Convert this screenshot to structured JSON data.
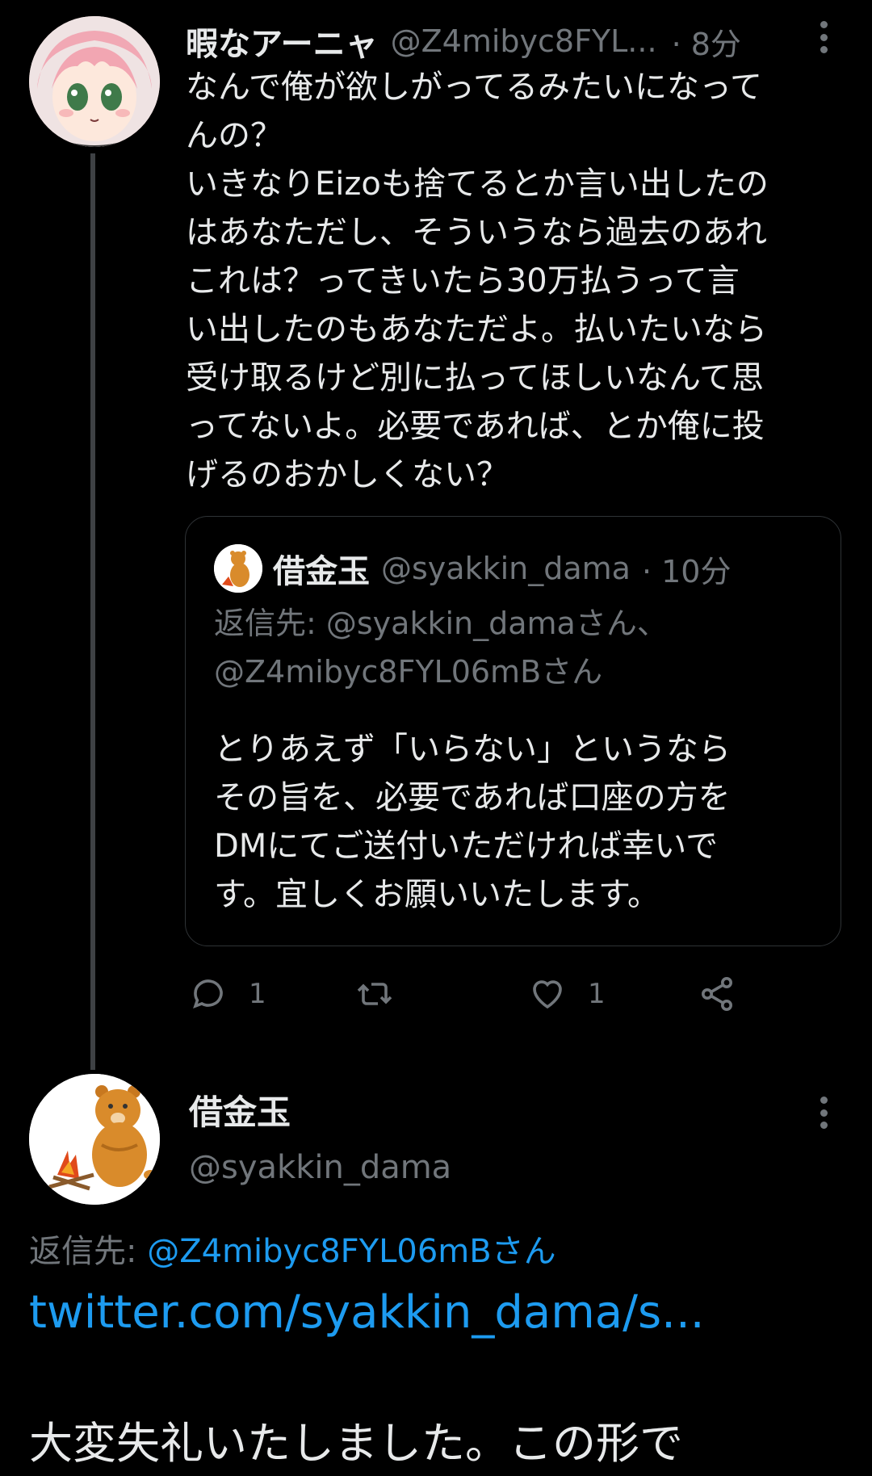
{
  "tweet1": {
    "display_name": "暇なアーニャ",
    "handle": "@Z4mibyc8FYL...",
    "time": "· 8分",
    "lines": [
      "なんで俺が欲しがってるみたいになって",
      "んの？",
      "いきなりEizoも捨てるとか言い出したの",
      "はあなただし、そういうなら過去のあれ",
      "これは？ってきいたら30万払うって言",
      "い出したのもあなただよ。払いたいなら",
      "受け取るけど別に払ってほしいなんて思",
      "ってないよ。必要であれば、とか俺に投",
      "げるのおかしくない？"
    ],
    "quote": {
      "display_name": "借金玉",
      "handle": "@syakkin_dama",
      "time": "· 10分",
      "reply_line1": "返信先: @syakkin_damaさん、",
      "reply_line2": "@Z4mibyc8FYL06mBさん",
      "lines": [
        "とりあえず「いらない」というなら",
        "その旨を、必要であれば口座の方を",
        "DMにてご送付いただければ幸いで",
        "す。宜しくお願いいたします。"
      ]
    },
    "reply_count": "1",
    "like_count": "1"
  },
  "tweet2": {
    "display_name": "借金玉",
    "handle": "@syakkin_dama",
    "reply_prefix": "返信先: ",
    "reply_target": "@Z4mibyc8FYL06mBさん",
    "link": "twitter.com/syakkin_dama/s...",
    "partial_text": "大変失礼いたしました。この形で"
  },
  "colors": {
    "background": "#000000",
    "text": "#e7e9ea",
    "muted": "#71767b",
    "accent": "#1d9bf0",
    "border": "#2f3336"
  },
  "icons": [
    "reply-icon",
    "retweet-icon",
    "like-icon",
    "share-icon",
    "more-icon"
  ]
}
